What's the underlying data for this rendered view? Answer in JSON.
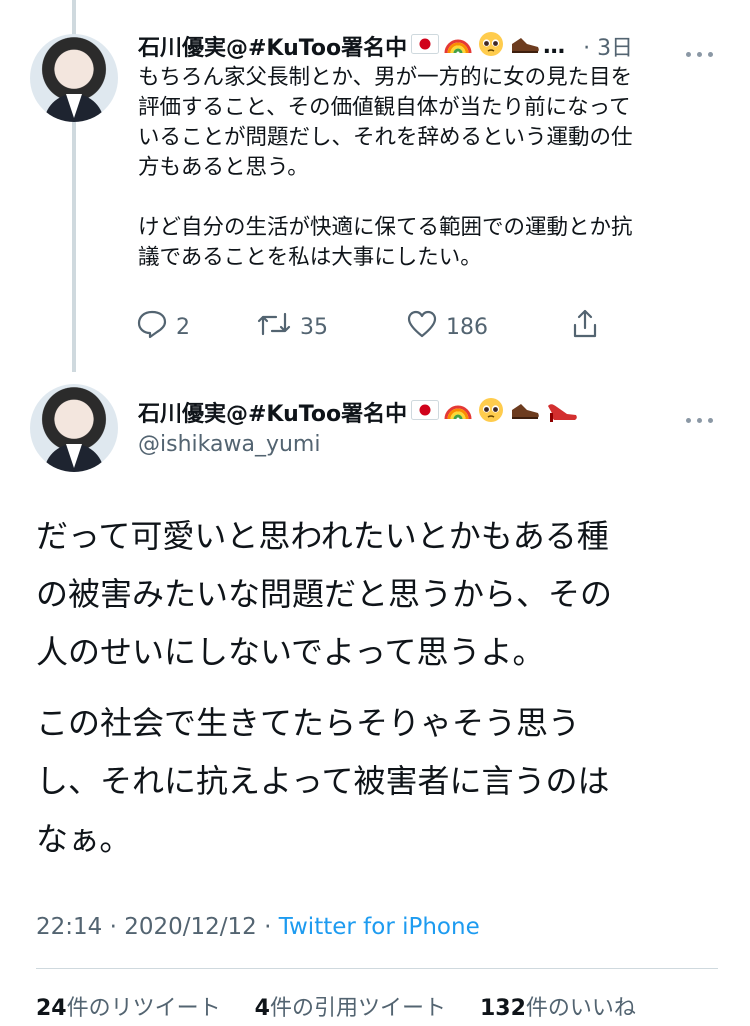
{
  "reply_tweet": {
    "display_name": "石川優実@#KuToo署名中",
    "timestamp": "· 3日",
    "text": "もちろん家父長制とか、男が一方的に女の見た目を\n評価すること、その価値観自体が当たり前になって\nいることが問題だし、それを辞めるという運動の仕\n方もあると思う。\n\nけど自分の生活が快適に保てる範囲での運動とか抗\n議であることを私は大事にしたい。",
    "replies": "2",
    "retweets": "35",
    "likes": "186"
  },
  "main_tweet": {
    "display_name": "石川優実@#KuToo署名中",
    "handle": "@ishikawa_yumi",
    "paragraph1": "だって可愛いと思われたいとかもある種\nの被害みたいな問題だと思うから、その\n人のせいにしないでよって思うよ。",
    "paragraph2": "この社会で生きてたらそりゃそう思う\nし、それに抗えよって被害者に言うのは\nなぁ。",
    "time": "22:14",
    "date": "2020/12/12",
    "source": "Twitter for iPhone",
    "stats": {
      "retweets_count": "24",
      "retweets_label": "件のリツイート",
      "quotes_count": "4",
      "quotes_label": "件の引用ツイート",
      "likes_count": "132",
      "likes_label": "件のいいね"
    }
  },
  "icons": [
    "japan-flag-icon",
    "rainbow-icon",
    "pleading-face-icon",
    "mans-shoe-icon",
    "high-heel-icon",
    "more-icon",
    "reply-icon",
    "retweet-icon",
    "like-icon",
    "share-icon"
  ],
  "colors": {
    "accent": "#1d9bf0",
    "secondary_text": "#536471",
    "divider": "#cfd9de"
  }
}
